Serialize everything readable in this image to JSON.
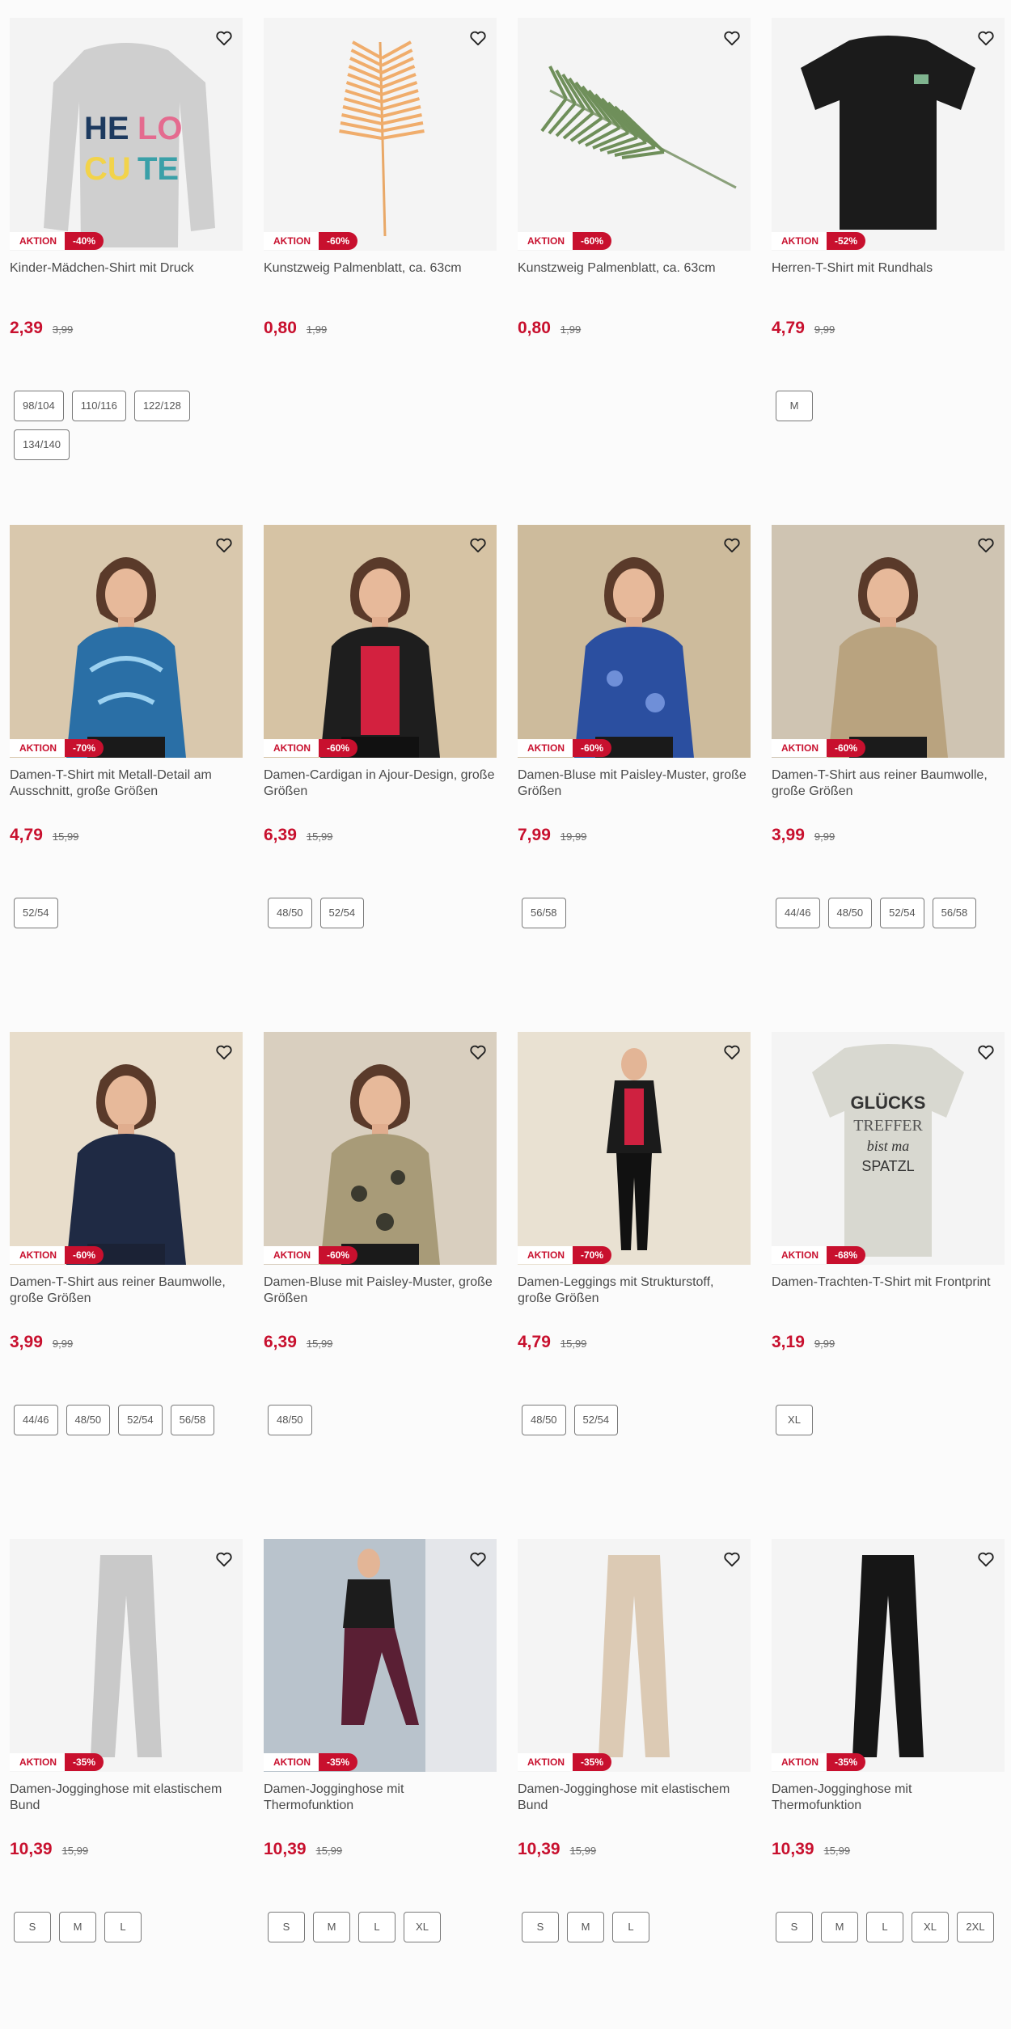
{
  "products": [
    {
      "id": "p1",
      "badge": "AKTION",
      "discount": "-40%",
      "title": "Kinder-Mädchen-Shirt mit Druck",
      "price": "2,39",
      "old_price": "3,99",
      "sizes": [
        "98/104",
        "110/116",
        "122/128",
        "134/140"
      ],
      "image_icon": "girls-longsleeve-shirt-print"
    },
    {
      "id": "p2",
      "badge": "AKTION",
      "discount": "-60%",
      "title": "Kunstzweig Palmenblatt, ca. 63cm",
      "price": "0,80",
      "old_price": "1,99",
      "sizes": [],
      "image_icon": "orange-palm-leaf"
    },
    {
      "id": "p3",
      "badge": "AKTION",
      "discount": "-60%",
      "title": "Kunstzweig Palmenblatt, ca. 63cm",
      "price": "0,80",
      "old_price": "1,99",
      "sizes": [],
      "image_icon": "green-palm-leaf"
    },
    {
      "id": "p4",
      "badge": "AKTION",
      "discount": "-52%",
      "title": "Herren-T-Shirt mit Rundhals",
      "price": "4,79",
      "old_price": "9,99",
      "sizes": [
        "M"
      ],
      "image_icon": "black-tshirt"
    },
    {
      "id": "p5",
      "badge": "AKTION",
      "discount": "-70%",
      "title": "Damen-T-Shirt mit Metall-Detail am Ausschnitt, große Größen",
      "price": "4,79",
      "old_price": "15,99",
      "sizes": [
        "52/54"
      ],
      "image_icon": "model-blue-pattern-shirt"
    },
    {
      "id": "p6",
      "badge": "AKTION",
      "discount": "-60%",
      "title": "Damen-Cardigan in Ajour-Design, große Größen",
      "price": "6,39",
      "old_price": "15,99",
      "sizes": [
        "48/50",
        "52/54"
      ],
      "image_icon": "model-black-cardigan"
    },
    {
      "id": "p7",
      "badge": "AKTION",
      "discount": "-60%",
      "title": "Damen-Bluse mit Paisley-Muster, große Größen",
      "price": "7,99",
      "old_price": "19,99",
      "sizes": [
        "56/58"
      ],
      "image_icon": "model-blue-paisley-blouse"
    },
    {
      "id": "p8",
      "badge": "AKTION",
      "discount": "-60%",
      "title": "Damen-T-Shirt aus reiner Baumwolle, große Größen",
      "price": "3,99",
      "old_price": "9,99",
      "sizes": [
        "44/46",
        "48/50",
        "52/54",
        "56/58"
      ],
      "image_icon": "model-beige-tshirt"
    },
    {
      "id": "p9",
      "badge": "AKTION",
      "discount": "-60%",
      "title": "Damen-T-Shirt aus reiner Baumwolle, große Größen",
      "price": "3,99",
      "old_price": "9,99",
      "sizes": [
        "44/46",
        "48/50",
        "52/54",
        "56/58"
      ],
      "image_icon": "model-navy-tshirt"
    },
    {
      "id": "p10",
      "badge": "AKTION",
      "discount": "-60%",
      "title": "Damen-Bluse mit Paisley-Muster, große Größen",
      "price": "6,39",
      "old_price": "15,99",
      "sizes": [
        "48/50"
      ],
      "image_icon": "model-beige-paisley-blouse"
    },
    {
      "id": "p11",
      "badge": "AKTION",
      "discount": "-70%",
      "title": "Damen-Leggings mit Strukturstoff, große Größen",
      "price": "4,79",
      "old_price": "15,99",
      "sizes": [
        "48/50",
        "52/54"
      ],
      "image_icon": "model-black-leggings"
    },
    {
      "id": "p12",
      "badge": "AKTION",
      "discount": "-68%",
      "title": "Damen-Trachten-T-Shirt mit Frontprint",
      "price": "3,19",
      "old_price": "9,99",
      "sizes": [
        "XL"
      ],
      "image_icon": "floral-print-tshirt"
    },
    {
      "id": "p13",
      "badge": "AKTION",
      "discount": "-35%",
      "title": "Damen-Jogginghose mit elastischem Bund",
      "price": "10,39",
      "old_price": "15,99",
      "sizes": [
        "S",
        "M",
        "L"
      ],
      "image_icon": "grey-jogging-pants"
    },
    {
      "id": "p14",
      "badge": "AKTION",
      "discount": "-35%",
      "title": "Damen-Jogginghose mit Thermofunktion",
      "price": "10,39",
      "old_price": "15,99",
      "sizes": [
        "S",
        "M",
        "L",
        "XL"
      ],
      "image_icon": "model-burgundy-jogging-pants"
    },
    {
      "id": "p15",
      "badge": "AKTION",
      "discount": "-35%",
      "title": "Damen-Jogginghose mit elastischem Bund",
      "price": "10,39",
      "old_price": "15,99",
      "sizes": [
        "S",
        "M",
        "L"
      ],
      "image_icon": "beige-jogging-pants"
    },
    {
      "id": "p16",
      "badge": "AKTION",
      "discount": "-35%",
      "title": "Damen-Jogginghose mit Thermofunktion",
      "price": "10,39",
      "old_price": "15,99",
      "sizes": [
        "S",
        "M",
        "L",
        "XL",
        "2XL"
      ],
      "image_icon": "black-jogging-pants"
    }
  ],
  "colors": {
    "accent": "#c8102e",
    "text": "#4a4a4a",
    "background": "#fbfbfb",
    "image_bg": "#eef0f2"
  },
  "favorite_icon": "heart-outline-icon"
}
